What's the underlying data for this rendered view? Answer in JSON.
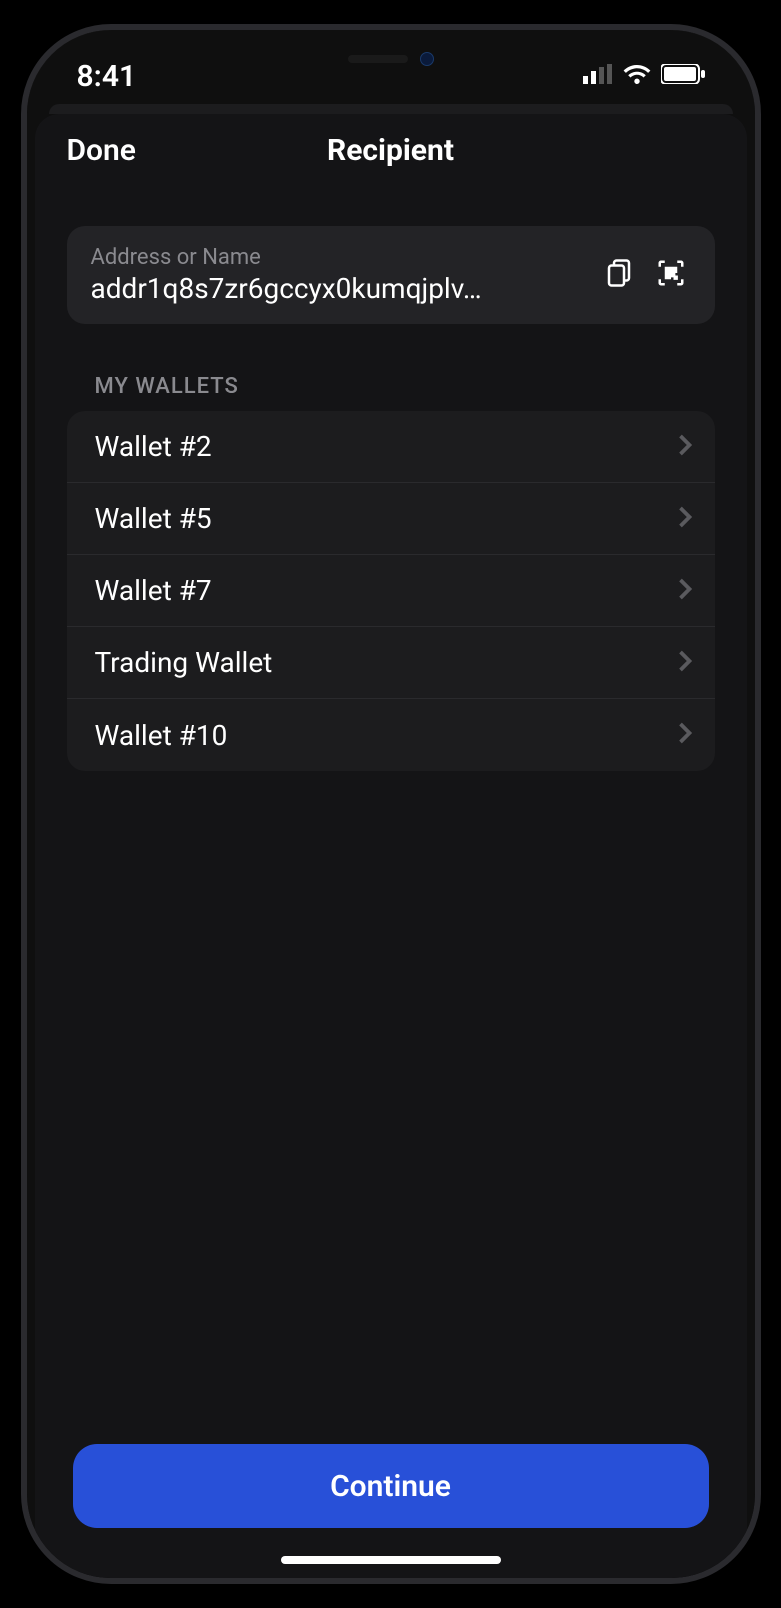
{
  "status": {
    "time": "8:41"
  },
  "nav": {
    "done": "Done",
    "title": "Recipient"
  },
  "address": {
    "label": "Address or Name",
    "value": "addr1q8s7zr6gccyx0kumqjplv…"
  },
  "section_label": "MY WALLETS",
  "wallets": [
    {
      "name": "Wallet #2"
    },
    {
      "name": "Wallet #5"
    },
    {
      "name": "Wallet #7"
    },
    {
      "name": "Trading Wallet"
    },
    {
      "name": "Wallet #10"
    }
  ],
  "continue_label": "Continue"
}
